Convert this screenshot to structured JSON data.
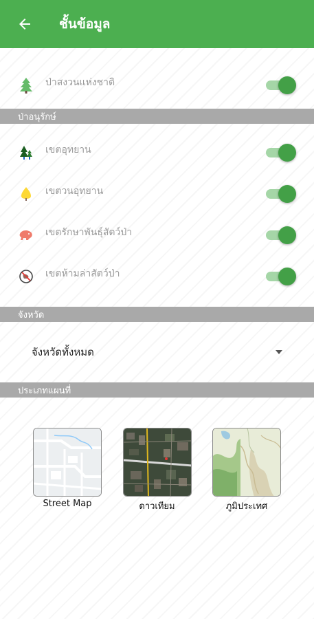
{
  "header": {
    "title": "ชั้นข้อมูล",
    "back_icon": "arrow-left-icon"
  },
  "national_park": {
    "label": "ป่าสงวนแห่งชาติ",
    "icon": "pine-tree-icon",
    "enabled": true
  },
  "conservation": {
    "section_title": "ป่าอนุรักษ์",
    "items": [
      {
        "label": "เขตอุทยาน",
        "icon": "forest-park-icon",
        "enabled": true
      },
      {
        "label": "เขตวนอุทยาน",
        "icon": "yellow-tree-icon",
        "enabled": true
      },
      {
        "label": "เขตรักษาพันธุ์สัตว์ป่า",
        "icon": "wildlife-icon",
        "enabled": true
      },
      {
        "label": "เขตห้ามล่าสัตว์ป่า",
        "icon": "no-hunting-icon",
        "enabled": true
      }
    ]
  },
  "province": {
    "section_title": "จังหวัด",
    "selected": "จังหวัดทั้งหมด"
  },
  "map_type": {
    "section_title": "ประเภทแผนที่",
    "options": [
      {
        "label": "Street Map"
      },
      {
        "label": "ดาวเทียม"
      },
      {
        "label": "ภูมิประเทศ"
      }
    ]
  },
  "colors": {
    "primary": "#4caf50",
    "toggle_on": "#43a047",
    "section_bg": "#a9a9a9"
  }
}
